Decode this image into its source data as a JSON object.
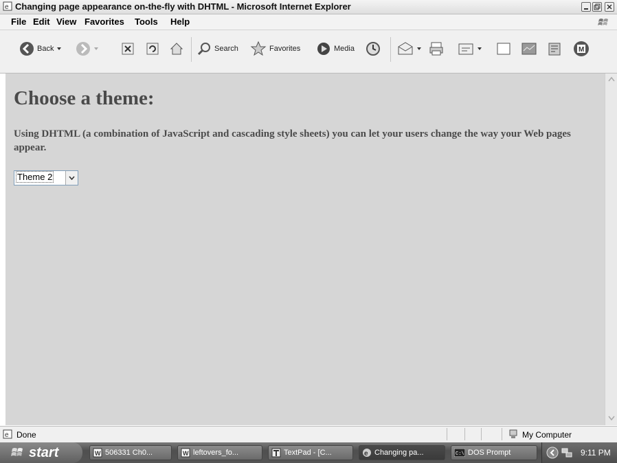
{
  "window": {
    "title": "Changing page appearance on-the-fly with DHTML - Microsoft Internet Explorer"
  },
  "menu": [
    "File",
    "Edit",
    "View",
    "Favorites",
    "Tools",
    "Help"
  ],
  "toolbar": {
    "back": "Back",
    "search": "Search",
    "favorites": "Favorites",
    "media": "Media"
  },
  "page": {
    "heading": "Choose a theme:",
    "description": "Using DHTML (a combination of JavaScript and cascading style sheets) you can let your users change the way your Web pages appear.",
    "theme_select_value": "Theme 2"
  },
  "status": {
    "text": "Done",
    "zone": "My Computer"
  },
  "taskbar": {
    "start": "start",
    "tasks": [
      "506331 Ch0...",
      "leftovers_fo...",
      "TextPad - [C...",
      "Changing pa...",
      "DOS Prompt"
    ],
    "clock": "9:11 PM"
  }
}
